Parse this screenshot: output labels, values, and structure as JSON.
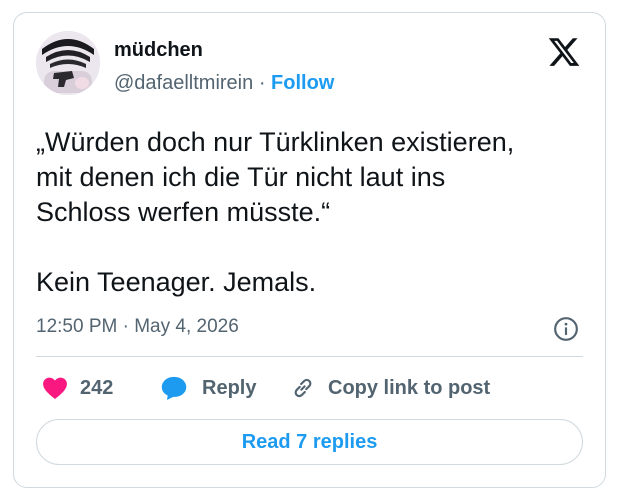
{
  "tweet": {
    "display_name": "müdchen",
    "handle": "@dafaelltmirein",
    "separator": "·",
    "follow_label": "Follow",
    "text": "„Würden doch nur Türklinken existieren,\nmit denen ich die Tür nicht laut ins\nSchloss werfen müsste.“\n\nKein Teenager. Jemals.",
    "timestamp": "12:50 PM · May 4, 2026"
  },
  "actions": {
    "likes_count": "242",
    "reply_label": "Reply",
    "copy_label": "Copy link to post"
  },
  "read_replies_label": "Read 7 replies",
  "colors": {
    "accent": "#1d9bf0",
    "like": "#f91880",
    "muted": "#536471",
    "border": "#cfd9de"
  },
  "icons": [
    "x-logo-icon",
    "info-icon",
    "heart-icon",
    "reply-bubble-icon",
    "link-icon"
  ]
}
